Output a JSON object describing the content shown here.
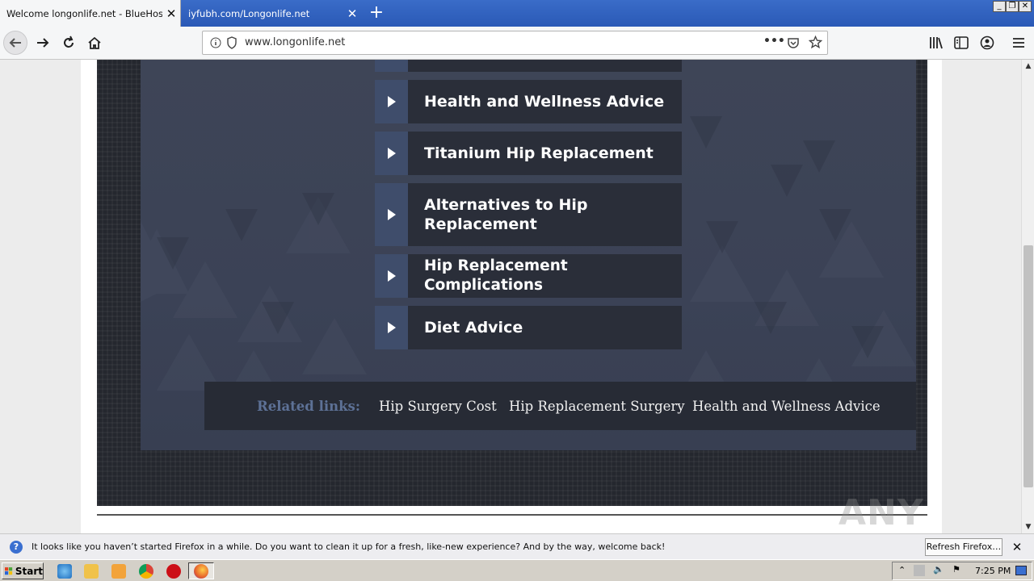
{
  "browser": {
    "tabs": [
      {
        "title": "Welcome longonlife.net - BlueHost.com"
      },
      {
        "title": "iyfubh.com/Longonlife.net"
      }
    ],
    "url": "www.longonlife.net"
  },
  "page": {
    "menu_items": [
      {
        "label": "Health and Wellness Advice"
      },
      {
        "label": "Titanium Hip Replacement"
      },
      {
        "label": "Alternatives to Hip Replacement"
      },
      {
        "label": "Hip Replacement Complications"
      },
      {
        "label": "Diet Advice"
      }
    ],
    "related": {
      "label": "Related links:",
      "links": [
        "Hip Surgery Cost",
        "Hip Replacement Surgery",
        "Health and Wellness Advice"
      ]
    },
    "watermark": "ANY RUN"
  },
  "notification": {
    "message": "It looks like you haven’t started Firefox in a while. Do you want to clean it up for a fresh, like-new experience? And by the way, welcome back!",
    "button": "Refresh Firefox…"
  },
  "taskbar": {
    "start": "Start",
    "clock": "7:25 PM"
  }
}
